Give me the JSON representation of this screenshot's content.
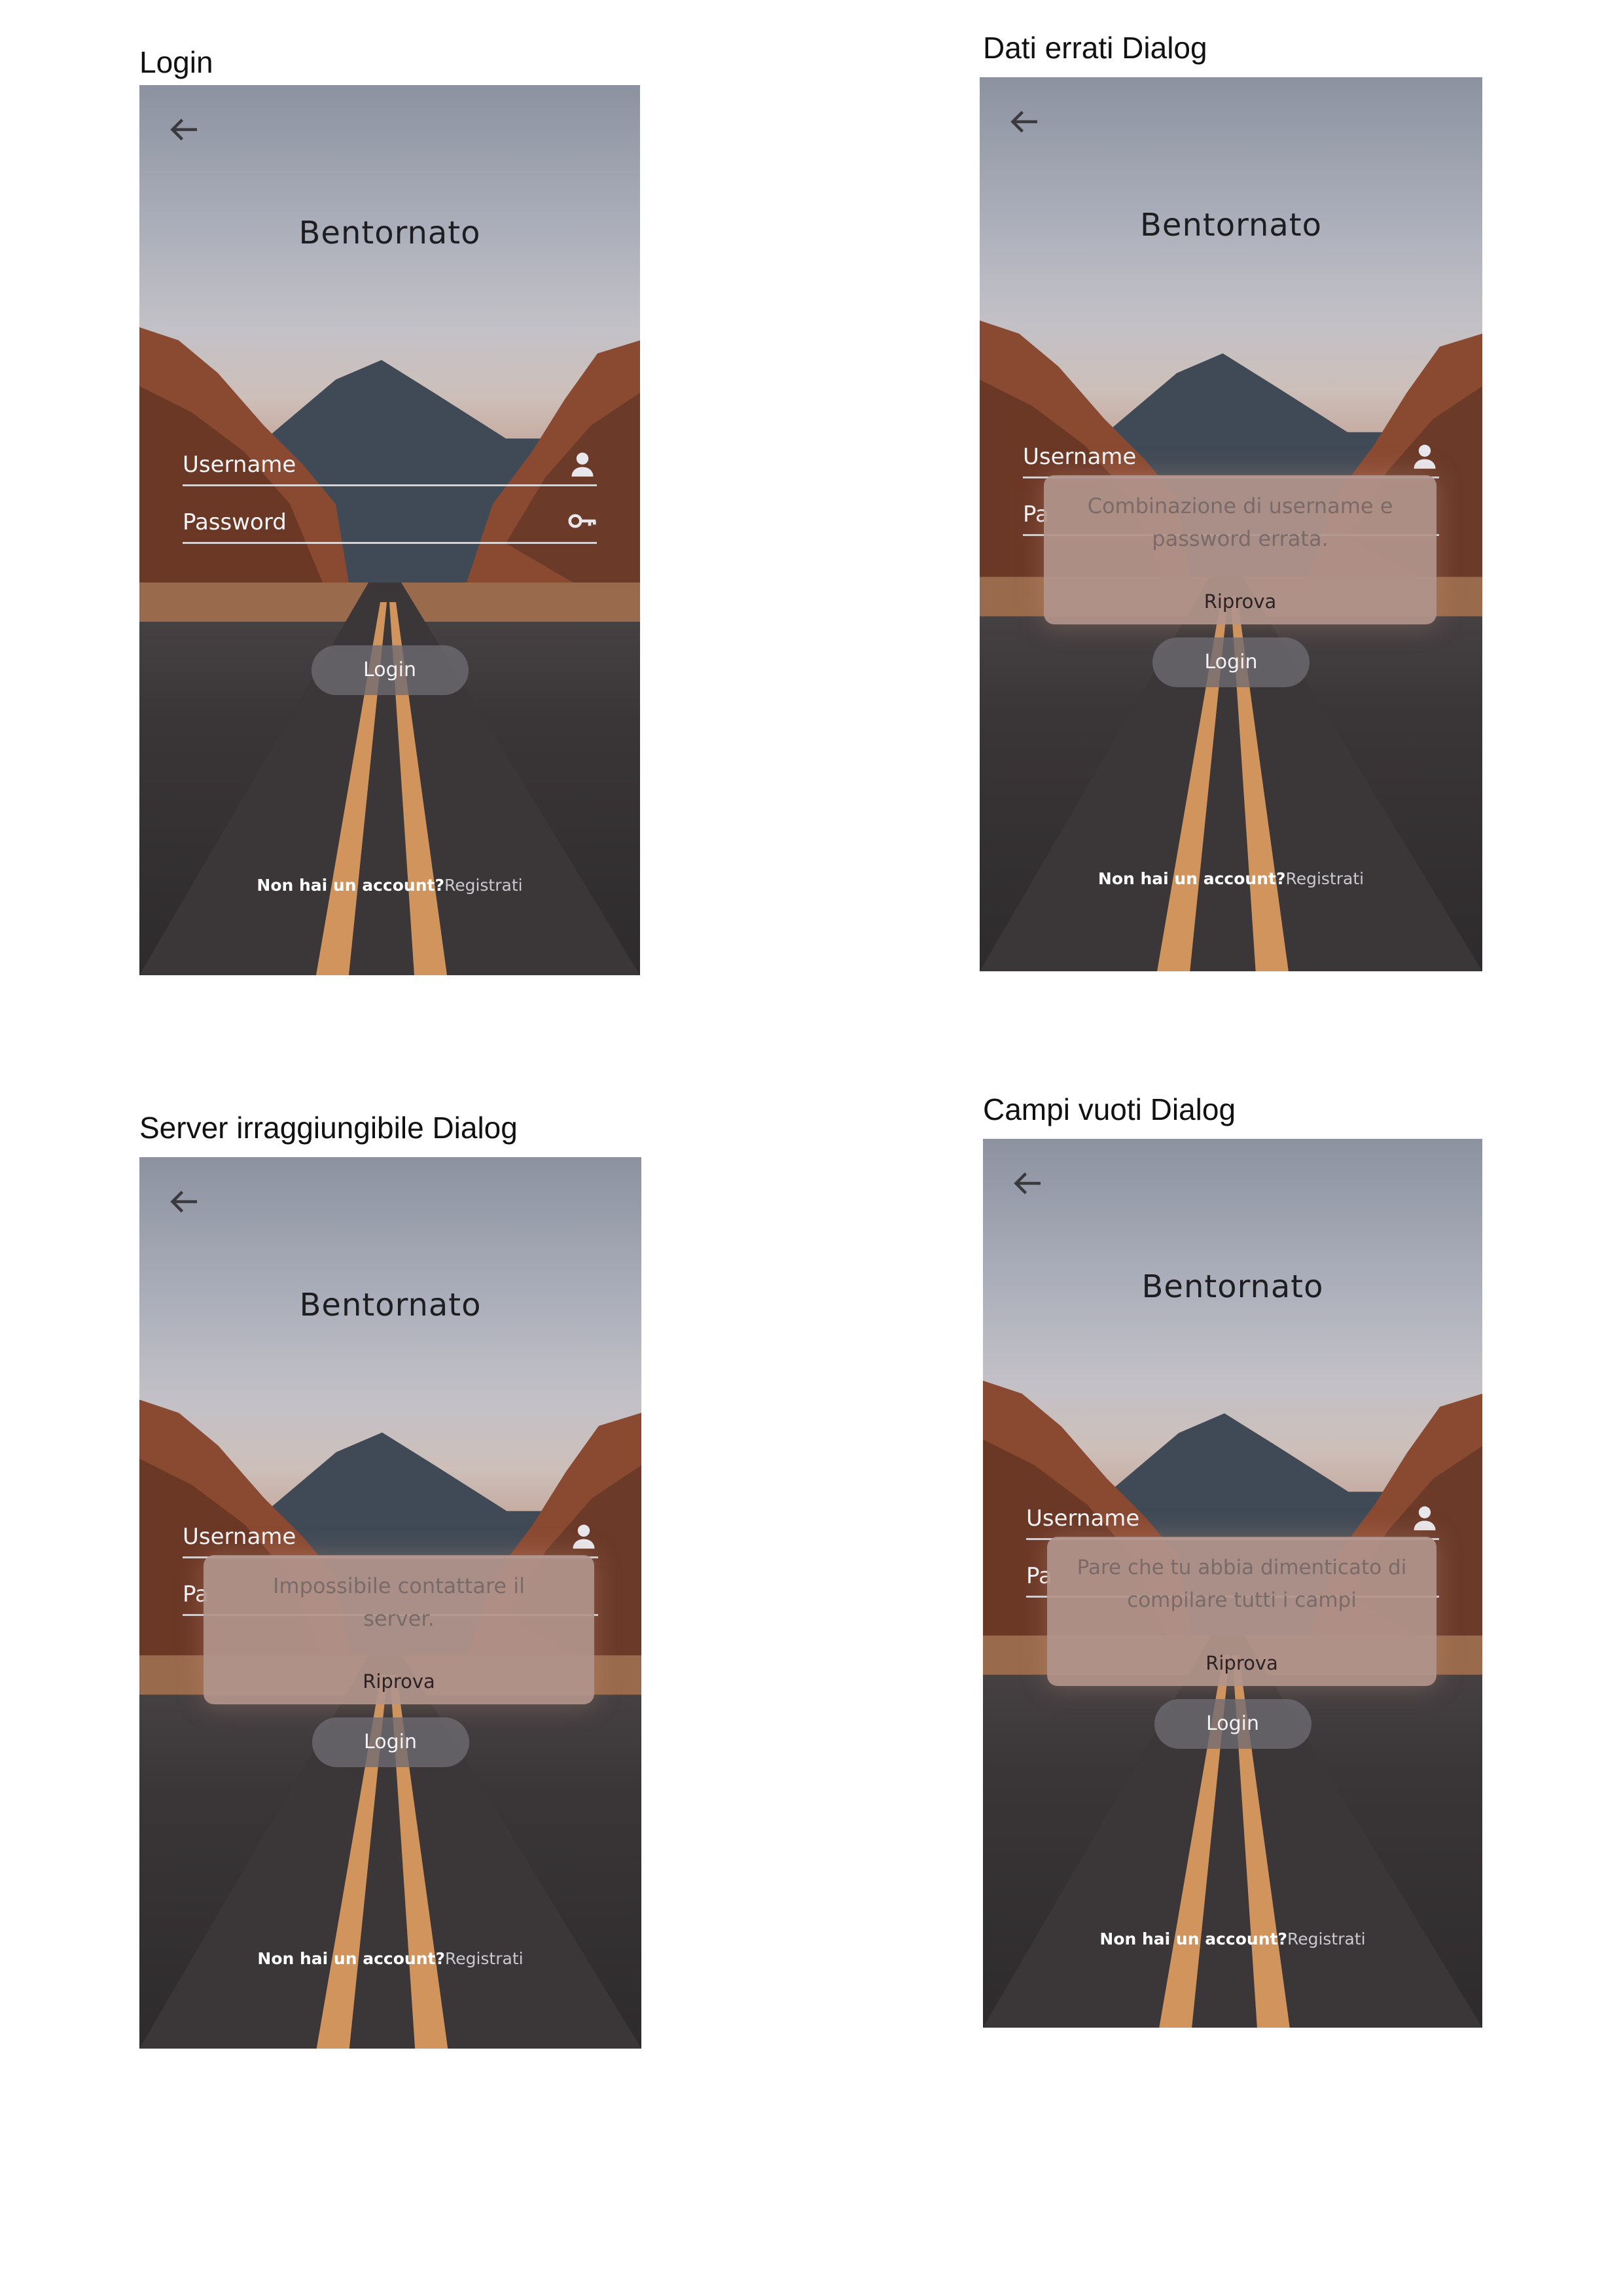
{
  "panels": [
    {
      "caption": "Login",
      "title": "Bentornato",
      "username_label": "Username",
      "password_label": "Password",
      "login_label": "Login",
      "footer_question": "Non hai un account?",
      "footer_link": "Registrati",
      "dialog": null
    },
    {
      "caption": "Dati errati Dialog",
      "title": "Bentornato",
      "username_label": "Username",
      "password_label": "Pa",
      "login_label": "Login",
      "footer_question": "Non hai un account?",
      "footer_link": "Registrati",
      "dialog": {
        "message": "Combinazione di username e password errata.",
        "button": "Riprova"
      }
    },
    {
      "caption": "Server irraggiungibile Dialog",
      "title": "Bentornato",
      "username_label": "Username",
      "password_label": "Pa",
      "login_label": "Login",
      "footer_question": "Non hai un account?",
      "footer_link": "Registrati",
      "dialog": {
        "message": "Impossibile contattare il server.",
        "button": "Riprova"
      }
    },
    {
      "caption": "Campi vuoti Dialog",
      "title": "Bentornato",
      "username_label": "Username",
      "password_label": "Pa",
      "login_label": "Login",
      "footer_question": "Non hai un account?",
      "footer_link": "Registrati",
      "dialog": {
        "message": "Pare che tu abbia dimenticato di compilare tutti i campi",
        "button": "Riprova"
      }
    }
  ],
  "icons": {
    "back": "arrow-left-icon",
    "user": "user-icon",
    "password": "key-icon"
  },
  "colors": {
    "dialog_bg": "#b2948c",
    "button_bg": "#6e6c72",
    "footer_link": "#c9c9cf"
  }
}
